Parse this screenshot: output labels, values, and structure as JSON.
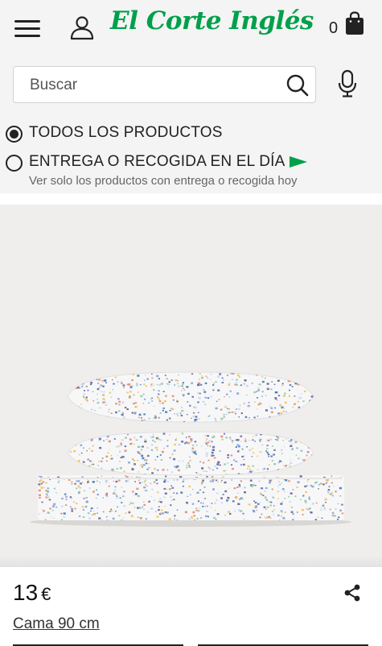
{
  "header": {
    "logo_text": "El Corte Inglés",
    "cart_count": "0"
  },
  "search": {
    "placeholder": "Buscar"
  },
  "filters": {
    "all_products": "TODOS LOS PRODUCTOS",
    "same_day": "ENTREGA O RECOGIDA EN EL DÍA",
    "same_day_sub": "Ver solo los productos con entrega o recogida hoy"
  },
  "product": {
    "price": "13",
    "currency": "€",
    "size_label": "Cama 90 cm"
  },
  "colors": {
    "brand": "#00a04b"
  },
  "icons": [
    "hamburger-menu-icon",
    "user-icon",
    "shopping-bag-icon",
    "search-icon",
    "microphone-icon",
    "share-icon",
    "delivery-flag-icon"
  ]
}
